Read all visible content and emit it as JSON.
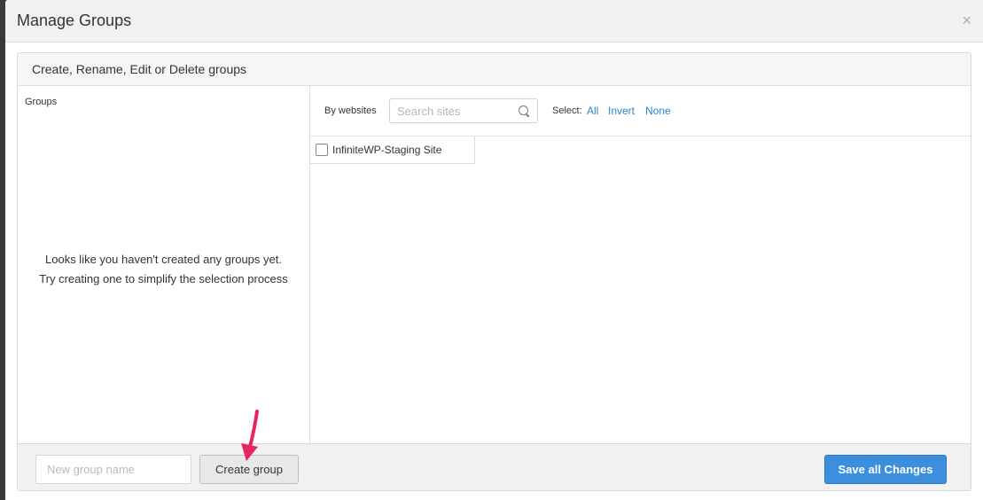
{
  "modal": {
    "title": "Manage Groups",
    "close_glyph": "×"
  },
  "panel": {
    "heading": "Create, Rename, Edit or Delete groups"
  },
  "groups": {
    "label": "Groups",
    "empty_line1": "Looks like you haven't created any groups yet.",
    "empty_line2": "Try creating one to simplify the selection process"
  },
  "sites": {
    "filter_label": "By websites",
    "search_placeholder": "Search sites",
    "select_label": "Select:",
    "select_all": "All",
    "select_invert": "Invert",
    "select_none": "None",
    "items": [
      {
        "name": "InfiniteWP-Staging Site",
        "checked": false
      }
    ]
  },
  "footer": {
    "new_group_placeholder": "New group name",
    "create_button": "Create group",
    "save_button": "Save all Changes"
  },
  "colors": {
    "link": "#2a87d0",
    "primary_button": "#3b8fdd",
    "annotation_arrow": "#e8265e"
  },
  "icons": [
    "close-icon",
    "search-icon",
    "checkbox-icon",
    "annotation-arrow"
  ]
}
